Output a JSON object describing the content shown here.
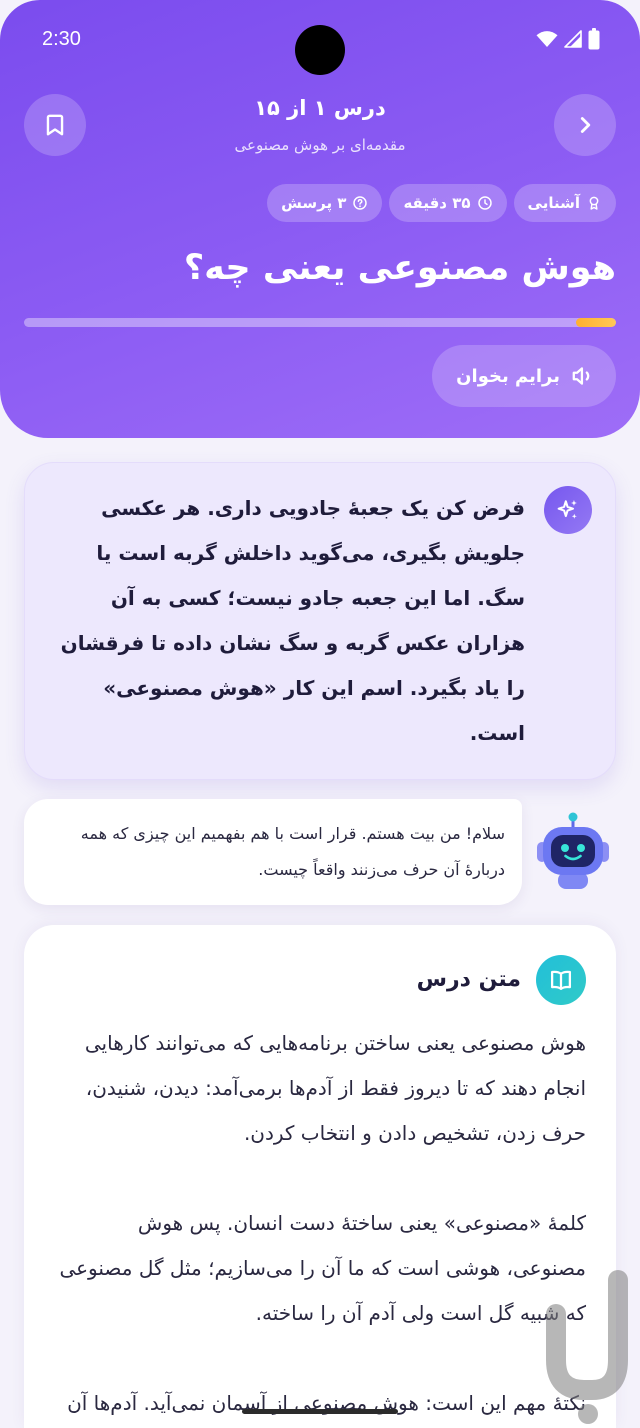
{
  "status_bar": {
    "time": "2:30",
    "icons": [
      "wifi-icon",
      "signal-icon",
      "battery-icon"
    ]
  },
  "header": {
    "back_icon": "chevron-right-icon",
    "bookmark_icon": "bookmark-icon",
    "lesson_counter": "درس ۱ از ۱۵",
    "course_title": "مقدمه‌ای بر هوش مصنوعی",
    "chips": [
      {
        "icon": "award-icon",
        "label": "آشنایی"
      },
      {
        "icon": "clock-icon",
        "label": "۳۵ دقیقه"
      },
      {
        "icon": "question-circle-icon",
        "label": "۳ پرسش"
      }
    ],
    "title": "هوش مصنوعی یعنی چه؟",
    "progress": 0.067,
    "read_aloud": {
      "icon": "speaker-icon",
      "label": "برایم بخوان"
    }
  },
  "intro_card": {
    "icon": "sparkle-icon",
    "text": "فرض کن یک جعبهٔ جادویی داری. هر عکسی جلویش بگیری، می‌گوید داخلش گربه است یا سگ. اما این جعبه جادو نیست؛ کسی به آن هزاران عکس گربه و سگ نشان داده تا فرقشان را یاد بگیرد. اسم این کار «هوش مصنوعی» است."
  },
  "mascot": {
    "icon": "robot-icon",
    "message": "سلام! من بیت هستم. قرار است با هم بفهمیم این چیزی که همه دربارهٔ آن حرف می‌زنند واقعاً چیست."
  },
  "lesson_card": {
    "icon": "book-icon",
    "heading": "متن درس",
    "paragraphs": [
      "هوش مصنوعی یعنی ساختن برنامه‌هایی که می‌توانند کارهایی انجام دهند که تا دیروز فقط از آدم‌ها برمی‌آمد: دیدن، شنیدن، حرف زدن، تشخیص دادن و انتخاب کردن.",
      "کلمهٔ «مصنوعی» یعنی ساختهٔ دست انسان. پس هوش مصنوعی، هوشی است که ما آن را می‌سازیم؛ مثل گل مصنوعی که شبیه گل است ولی آدم آن را ساخته.",
      "نکتهٔ مهم این است: هوش مصنوعی از آسمان نمی‌آید. آدم‌ها آن را می‌سازند، به آن مثال نشان می‌دهند و"
    ]
  },
  "colors": {
    "header_start": "#7B4CEE",
    "header_end": "#9E6DF7",
    "progress_fill": "#FFB02E",
    "intro_card_bg": "#EDE8FD",
    "sparkle_badge": "#7657EE",
    "book_badge": "#22BFD9",
    "page_bg": "#F4F2FB"
  }
}
